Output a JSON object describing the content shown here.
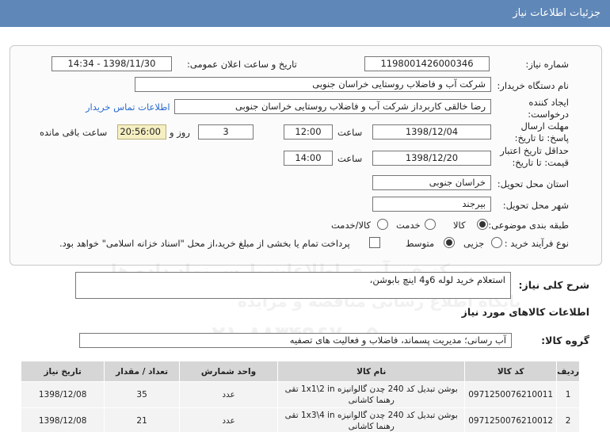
{
  "header": {
    "title": "جزئیات اطلاعات نیاز"
  },
  "form": {
    "need_number_label": "شماره نیاز:",
    "need_number": "1198001426000346",
    "announce_label": "تاریخ و ساعت اعلان عمومی:",
    "announce_value": "1398/11/30 - 14:34",
    "buyer_label": "نام دستگاه خریدار:",
    "buyer_value": "شرکت آب و فاضلاب روستایی خراسان جنوبی",
    "creator_label": "ایجاد کننده درخواست:",
    "creator_value": "رضا  خالقی کاربرداز شرکت آب و فاضلاب روستایی خراسان جنوبی",
    "contact_link": "اطلاعات تماس خریدار",
    "deadline_label": "مهلت ارسال پاسخ: تا تاریخ:",
    "deadline_date": "1398/12/04",
    "time_label": "ساعت",
    "deadline_time": "12:00",
    "days_value": "3",
    "days_label": "روز و",
    "remaining_time": "20:56:00",
    "remaining_label": "ساعت باقی مانده",
    "validity_label": "حداقل تاریخ اعتبار قیمت: تا تاریخ:",
    "validity_date": "1398/12/20",
    "validity_time": "14:00",
    "province_label": "استان محل تحویل:",
    "province_value": "خراسان جنوبی",
    "city_label": "شهر محل تحویل:",
    "city_value": "بیرجند",
    "category_label": "طبقه بندی موضوعی:",
    "category_options": [
      "کالا",
      "خدمت",
      "کالا/خدمت"
    ],
    "purchase_label": "نوع فرآیند خرید :",
    "purchase_options": [
      "جزیی",
      "متوسط"
    ],
    "payment_note": "پرداخت تمام یا بخشی از مبلغ خرید،از محل \"اسناد خزانه اسلامی\" خواهد بود."
  },
  "description": {
    "label": "شرح کلی نیاز:",
    "value": "استعلام خرید لوله 6و4 اینچ بابوشن،"
  },
  "goods": {
    "section_title": "اطلاعات کالاهای مورد نیاز",
    "group_label": "گروه کالا:",
    "group_value": "آب رسانی؛ مدیریت پسماند، فاضلاب و فعالیت های تصفیه"
  },
  "table": {
    "headers": [
      "ردیف",
      "کد کالا",
      "نام کالا",
      "واحد شمارش",
      "تعداد / مقدار",
      "تاریخ نیاز"
    ],
    "rows": [
      {
        "row": "1",
        "code": "0971250076210011",
        "name": "بوشن تبدیل کد 240 چدن گالوانیزه 1x1\\2 in تقی رهنما کاشانی",
        "unit": "عدد",
        "qty": "35",
        "date": "1398/12/08"
      },
      {
        "row": "2",
        "code": "0971250076210012",
        "name": "بوشن تبدیل کد 240 چدن گالوانیزه 1x3\\4 in تقی رهنما کاشانی",
        "unit": "عدد",
        "qty": "21",
        "date": "1398/12/08"
      }
    ]
  },
  "watermark": {
    "line1": "پایگاه اطلاع رسانی مناقصه و مزایده",
    "line2": "۰۲۱-۸۸۳۴۹۶۷۰-۵",
    "line3": "مرکز فن آوری اطلاعات پارس نماد داده ها"
  }
}
